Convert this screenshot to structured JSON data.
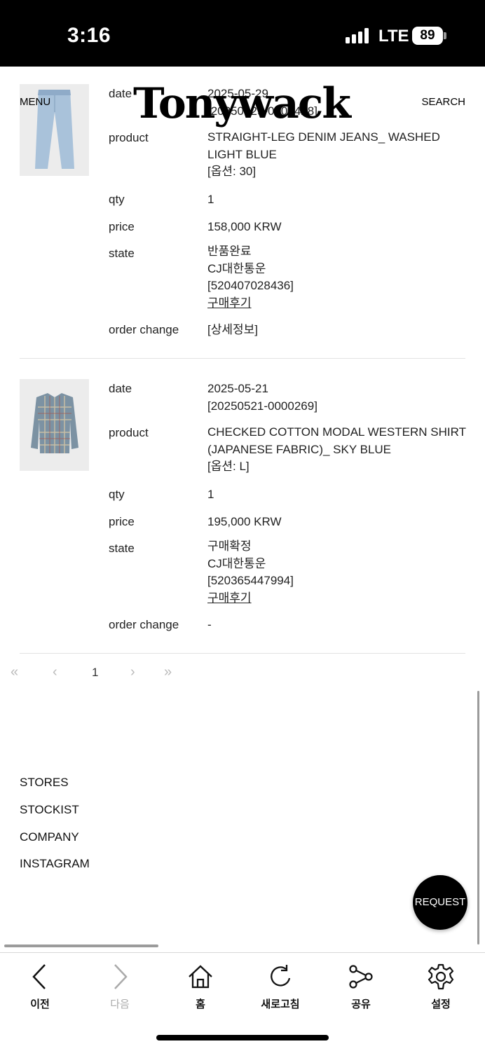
{
  "status_bar": {
    "time": "3:16",
    "network": "LTE",
    "battery": "89"
  },
  "header": {
    "menu": "MENU",
    "logo": "Tonywack",
    "search": "SEARCH"
  },
  "labels": {
    "date": "date",
    "product": "product",
    "qty": "qty",
    "price": "price",
    "state": "state",
    "order_change": "order change"
  },
  "orders": [
    {
      "image": "jeans-image",
      "date": "2025-05-29",
      "order_no": "[20250529-0003428]",
      "product_line1": "STRAIGHT-LEG DENIM JEANS_ WASHED",
      "product_line2": "LIGHT BLUE",
      "option": "[옵션: 30]",
      "qty": "1",
      "price": "158,000 KRW",
      "state": "반품완료",
      "courier": "CJ대한통운",
      "tracking": "[520407028436]",
      "review": "구매후기",
      "order_change": "[상세정보]"
    },
    {
      "image": "shirt-image",
      "date": "2025-05-21",
      "order_no": "[20250521-0000269]",
      "product_line1": "CHECKED COTTON MODAL WESTERN SHIRT",
      "product_line2": "(JAPANESE FABRIC)_ SKY BLUE",
      "option": "[옵션: L]",
      "qty": "1",
      "price": "195,000 KRW",
      "state": "구매확정",
      "courier": "CJ대한통운",
      "tracking": "[520365447994]",
      "review": "구매후기",
      "order_change": "-"
    }
  ],
  "pagination": {
    "first": "«",
    "prev": "‹",
    "current": "1",
    "next": "›",
    "last": "»"
  },
  "footer": {
    "stores": "STORES",
    "stockist": "STOCKIST",
    "company": "COMPANY",
    "instagram": "INSTAGRAM"
  },
  "request_button": "REQUEST",
  "toolbar": {
    "back": "이전",
    "forward": "다음",
    "home": "홈",
    "refresh": "새로고침",
    "share": "공유",
    "settings": "설정"
  }
}
